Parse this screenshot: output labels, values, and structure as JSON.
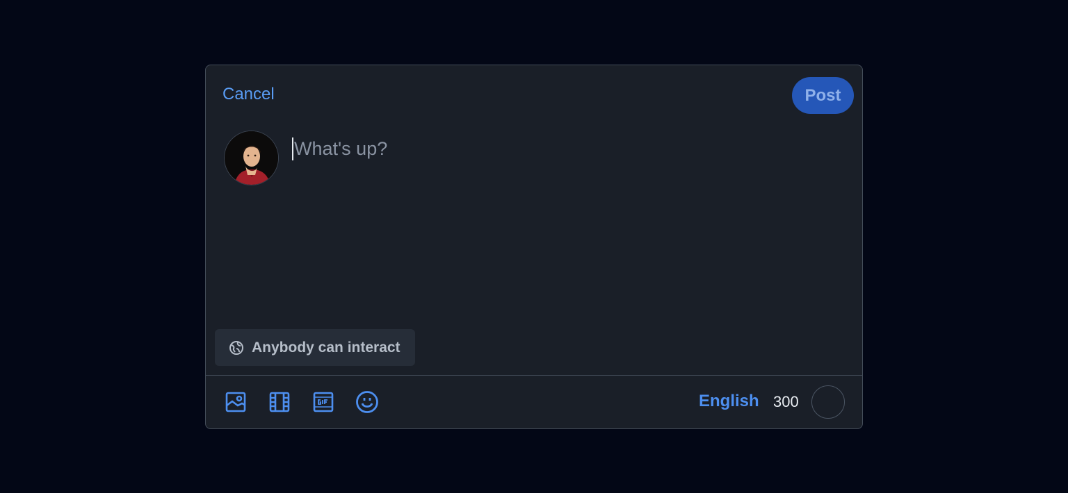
{
  "composer": {
    "cancel_label": "Cancel",
    "post_label": "Post",
    "placeholder": "What's up?",
    "interaction_setting": "Anybody can interact",
    "language": "English",
    "char_count": "300"
  },
  "toolbar": {
    "icons": [
      "image-icon",
      "video-icon",
      "gif-icon",
      "emoji-icon"
    ]
  },
  "colors": {
    "accent": "#4d8ff0",
    "post_button": "#2557b8",
    "panel": "#1a1f28",
    "background": "#030716"
  }
}
